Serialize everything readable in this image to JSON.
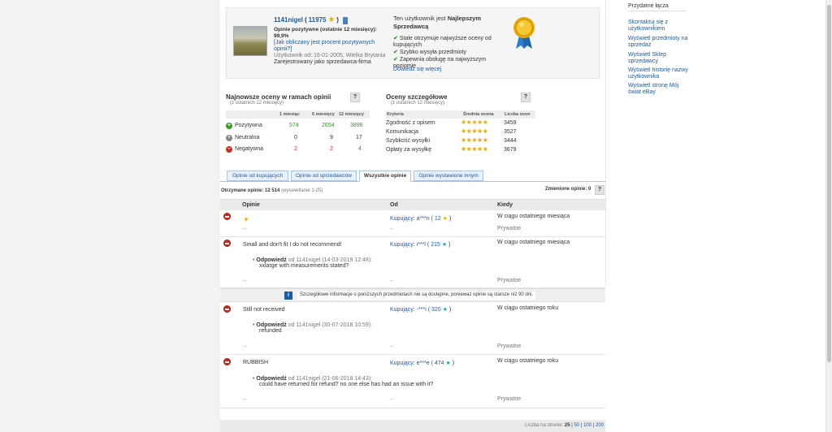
{
  "profile": {
    "username": "1141nigel",
    "score_open": "(",
    "score": "11975",
    "score_close": ")",
    "positive_label": "Opinie pozytywne (ostatnie 12 miesięcy):",
    "positive_value": "99,9%",
    "calc_link": "[Jak obliczany jest procent pozytywnych opinii?]",
    "member_since": "Użytkownik od: 16-01-2005, Wielka Brytania",
    "registered_as": "Zarejestrowany jako sprzedawca-firma"
  },
  "seller": {
    "line1": "Ten użytkownik jest",
    "badge": "Najlepszym Sprzedawcą",
    "points": [
      "Stale otrzymuje najwyższe oceny od kupujących",
      "Szybko wysyła przedmioty",
      "Zapewnia obsługę na najwyższym poziomie"
    ],
    "more_link": "Dowiedz się więcej"
  },
  "sidebar": {
    "title": "Przydatne łącza",
    "links": [
      "Skontaktuj się z użytkownikiem",
      "Wyświetl przedmioty na sprzedaż",
      "Wyświetl Sklep sprzedawcy",
      "Wyświetl historię nazwy użytkownika",
      "Wyświetl stronę Mój świat eBay"
    ]
  },
  "recent": {
    "title": "Najnowsze oceny w ramach opinii",
    "subtitle": "(z ostatnich 12 miesięcy)",
    "help": "?",
    "columns": [
      "1 miesiąc",
      "6 miesięcy",
      "12 miesięcy"
    ],
    "rows": [
      {
        "label": "Pozytywna",
        "icon": "+",
        "v1": "574",
        "v2": "2654",
        "v3": "3896"
      },
      {
        "label": "Neutralna",
        "icon": "•",
        "v1": "0",
        "v2": "9",
        "v3": "17"
      },
      {
        "label": "Negatywna",
        "icon": "–",
        "v1": "2",
        "v2": "2",
        "v3": "4"
      }
    ]
  },
  "detailed": {
    "title": "Oceny szczegółowe",
    "subtitle": "(z ostatnich 12 miesięcy)",
    "help": "?",
    "columns": [
      "Kryteria",
      "Średnia ocena",
      "Liczba ocen"
    ],
    "rows": [
      {
        "label": "Zgodność z opisem",
        "stars": "★★★★★",
        "count": "3459"
      },
      {
        "label": "Komunikacja",
        "stars": "★★★★★",
        "count": "3527"
      },
      {
        "label": "Szybkość wysyłki",
        "stars": "★★★★★",
        "count": "3444"
      },
      {
        "label": "Opłaty za wysyłkę",
        "stars": "★★★★★",
        "count": "3679"
      }
    ]
  },
  "tabs": [
    "Opinie od kupujących",
    "Opinie od sprzedawców",
    "Wszystkie opinie",
    "Opinie wystawione innym"
  ],
  "summary": {
    "received_label": "Otrzymane opinie:",
    "received_value": "12 514",
    "showing": "(wyświetlanie 1-25)",
    "changed_label": "Zmienione opinie:",
    "changed_value": "0",
    "help": "?"
  },
  "feedback_table": {
    "col_feedback": "Opinie",
    "col_from": "Od",
    "col_when": "Kiedy",
    "dash": "--",
    "private": "Prywatne",
    "reply_word": "Odpowiedź",
    "entries": [
      {
        "text": "",
        "from": "Kupujący: a***n ( 12",
        "when": "W ciągu ostatniego miesiąca"
      },
      {
        "text": "Small and don't fit I do not recommend!",
        "from": "Kupujący: i***l ( 215",
        "when": "W ciągu ostatniego miesiąca",
        "reply_meta": "od 1141nigel (14-03-2019 12:48):",
        "reply_text": "xxlarge with measurements stated?"
      },
      {
        "text": "Still not received",
        "from": "Kupujący: -***i ( 320",
        "when": "W ciągu ostatniego roku",
        "reply_meta": "od 1141nigel (30-07-2018 10:59):",
        "reply_text": "refunded"
      },
      {
        "text": "RUBBISH",
        "from": "Kupujący: e***e ( 474",
        "when": "W ciągu ostatniego roku",
        "reply_meta": "od 1141nigel (21-06-2018 14:43):",
        "reply_text": "could have returned for refund? no one else has had an issue with it?"
      }
    ],
    "info_message": "Szczegółowe informacje o poniższych przedmiotach nie są dostępne, ponieważ opinie są starsze niż 90 dni."
  },
  "pager": {
    "label": "Liczba na stronie:",
    "options": [
      "25",
      "50",
      "100",
      "200"
    ]
  },
  "colors": {
    "link": "#1a5aa6",
    "positive": "#2f9a1f",
    "negative": "#d8352a",
    "star": "#f5a300"
  }
}
